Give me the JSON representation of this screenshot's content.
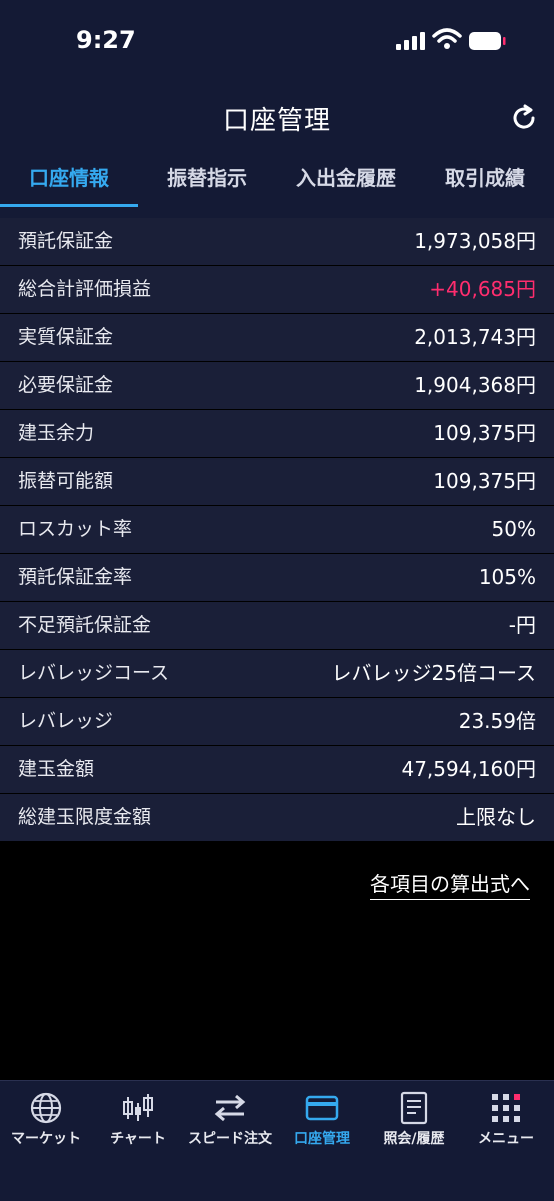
{
  "status_bar": {
    "time": "9:27"
  },
  "header": {
    "title": "口座管理"
  },
  "tabs": [
    {
      "label": "口座情報",
      "active": true
    },
    {
      "label": "振替指示",
      "active": false
    },
    {
      "label": "入出金履歴",
      "active": false
    },
    {
      "label": "取引成績",
      "active": false
    }
  ],
  "rows": [
    {
      "label": "預託保証金",
      "value": "1,973,058円"
    },
    {
      "label": "総合計評価損益",
      "value": "+40,685円"
    },
    {
      "label": "実質保証金",
      "value": "2,013,743円"
    },
    {
      "label": "必要保証金",
      "value": "1,904,368円"
    },
    {
      "label": "建玉余力",
      "value": "109,375円"
    },
    {
      "label": "振替可能額",
      "value": "109,375円"
    },
    {
      "label": "ロスカット率",
      "value": "50%"
    },
    {
      "label": "預託保証金率",
      "value": "105%"
    },
    {
      "label": "不足預託保証金",
      "value": "-円"
    },
    {
      "label": "レバレッジコース",
      "value": "レバレッジ25倍コース"
    },
    {
      "label": "レバレッジ",
      "value": "23.59倍"
    },
    {
      "label": "建玉金額",
      "value": "47,594,160円"
    },
    {
      "label": "総建玉限度金額",
      "value": "上限なし"
    }
  ],
  "formula_link": "各項目の算出式へ",
  "bottom_nav": [
    {
      "label": "マーケット",
      "icon": "globe-icon"
    },
    {
      "label": "チャート",
      "icon": "candlestick-icon"
    },
    {
      "label": "スピード注文",
      "icon": "swap-arrows-icon"
    },
    {
      "label": "口座管理",
      "icon": "card-icon",
      "active": true
    },
    {
      "label": "照会/履歴",
      "icon": "document-icon"
    },
    {
      "label": "メニュー",
      "icon": "grid-menu-icon"
    }
  ],
  "colors": {
    "accent": "#35a9ef",
    "positive": "#ff2d6e",
    "panel": "#1a1f38",
    "header": "#141a35"
  }
}
